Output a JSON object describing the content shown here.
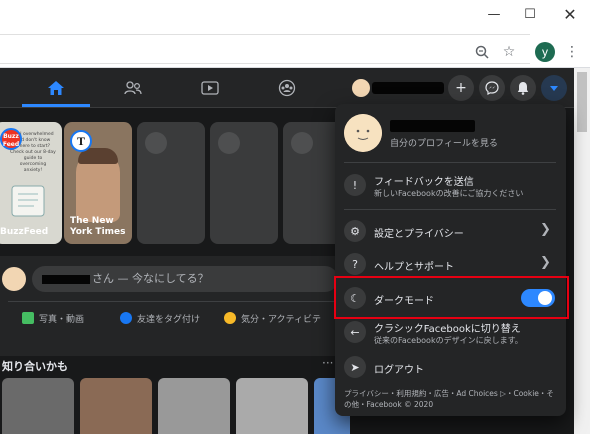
{
  "browser": {
    "minimize_icon": "minimize",
    "maximize_icon": "maximize",
    "close_icon": "close",
    "profile_initial": "y"
  },
  "nav": {
    "items": [
      "home-icon",
      "friends-icon",
      "watch-icon",
      "groups-icon"
    ]
  },
  "stories": [
    {
      "name": "BuzzFeed",
      "badge": "Buzz Feed",
      "caption": "Feel overwhelmed and don't know where to start? Check out our 8-day guide to overcoming anxiety!"
    },
    {
      "name": "The New York Times",
      "badge": "T"
    }
  ],
  "composer": {
    "placeholder": "さん — 今なにしてる？",
    "actions": [
      {
        "label": "写真・動画",
        "color": "#45bd62"
      },
      {
        "label": "友達をタグ付け",
        "color": "#1877f2"
      },
      {
        "label": "気分・アクティビテ",
        "color": "#f7b928"
      }
    ]
  },
  "section": {
    "title": "知り合いかも",
    "more": "···"
  },
  "menu": {
    "profile_sub": "自分のプロフィールを見る",
    "feedback": {
      "label": "フィードバックを送信",
      "desc": "新しいFacebookの改善にご協力ください"
    },
    "settings": {
      "label": "設定とプライバシー"
    },
    "help": {
      "label": "ヘルプとサポート"
    },
    "dark": {
      "label": "ダークモード",
      "enabled": true
    },
    "classic": {
      "label": "クラシックFacebookに切り替え",
      "desc": "従来のFacebookのデザインに戻します。"
    },
    "logout": {
      "label": "ログアウト"
    },
    "footer": "プライバシー・利用規約・広告・Ad Choices ▷・Cookie・その他・Facebook © 2020"
  }
}
